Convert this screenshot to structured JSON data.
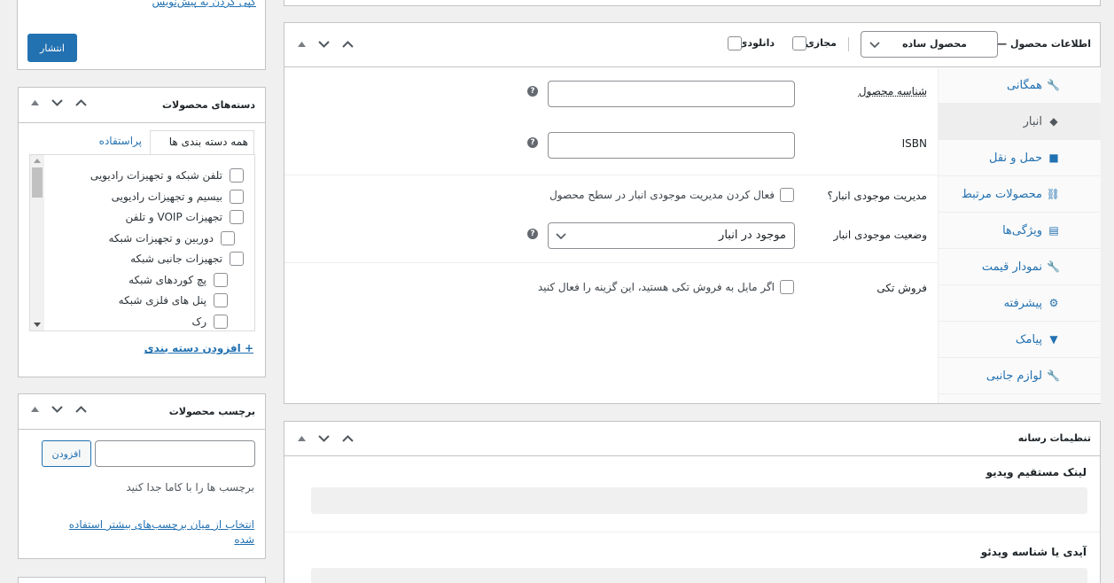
{
  "publish": {
    "top_link": "کپی کردن به پیش‌نویس",
    "publish_btn": "انتشار"
  },
  "categories": {
    "title": "دسته‌های محصولات",
    "tab_all": "همه دسته بندی ها",
    "tab_popular": "پراستفاده",
    "items": [
      "تلفن شبکه و تجهیزات رادیویی",
      "بیسیم و تجهیزات رادیویی",
      "تجهیزات VOIP و تلفن",
      "دوربین و تجهیزات شبکه",
      "تجهیزات جانبی شبکه",
      "پچ کوردهای شبکه",
      "پنل های فلزی شبکه",
      "رک"
    ],
    "add_link": "+ افزودن دسته بندی"
  },
  "tags": {
    "title": "برچسب محصولات",
    "add_btn": "افزودن",
    "hint": "برچسب ها را با کاما جدا کنید",
    "choose_line1": "انتخاب از میان برچسب‌های بیشتر استفاده",
    "choose_line2": "شده"
  },
  "product_data": {
    "title": "اطلاعات محصول —",
    "type_select": "محصول ساده",
    "virtual_label": "مجازی:",
    "download_label": "دانلودی:",
    "tabs": [
      {
        "label": "همگانی",
        "icon": "wrench-icon"
      },
      {
        "label": "انبار",
        "icon": "tag-icon"
      },
      {
        "label": "حمل و نقل",
        "icon": "truck-icon"
      },
      {
        "label": "محصولات مرتبط",
        "icon": "link-icon"
      },
      {
        "label": "ویژگی‌ها",
        "icon": "table-icon"
      },
      {
        "label": "نمودار قیمت",
        "icon": "wrench-icon"
      },
      {
        "label": "پیشرفته",
        "icon": "gear-icon"
      },
      {
        "label": "پیامک",
        "icon": "comment-icon"
      },
      {
        "label": "لوازم جانبی",
        "icon": "wrench-icon"
      }
    ],
    "sku_label": "شناسه محصول",
    "sku_value": "",
    "isbn_label": "ISBN",
    "isbn_value": "",
    "manage_stock_label": "مدیریت موجودی انبار؟",
    "manage_stock_text": "فعال کردن مدیریت موجودی انبار در سطح محصول",
    "stock_status_label": "وضعیت موجودی انبار",
    "stock_status_value": "موجود در انبار",
    "sold_individually_label": "فروش تکی",
    "sold_individually_text": "اگر مایل به فروش تکی هستید، این گزینه را فعال کنید",
    "help_glyph": "?"
  },
  "media": {
    "title": "تنظیمات رسانه",
    "video_link_label": "لینک مستقیم ویدیو",
    "video_id_label": "آیدی یا شناسه ویدئو"
  }
}
